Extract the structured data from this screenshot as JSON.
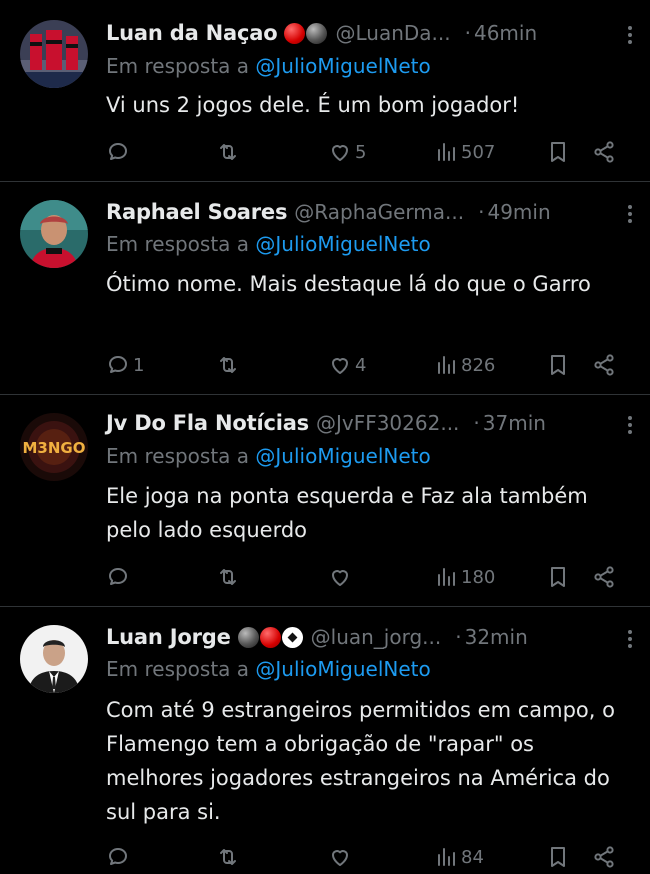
{
  "tweets": [
    {
      "name": "Luan da Naçao",
      "badges": [
        "red",
        "black"
      ],
      "handle": "@LuanDa...",
      "separator": "·",
      "time": "46min",
      "reply_prefix": "Em resposta a ",
      "reply_mention": "@JulioMiguelNeto",
      "text": "Vi uns 2 jogos dele. É um bom jogador!",
      "replies": "",
      "reposts": "",
      "likes": "5",
      "views": "507"
    },
    {
      "name": "Raphael Soares",
      "badges": [],
      "handle": "@RaphaGerma...",
      "separator": "·",
      "time": "49min",
      "reply_prefix": "Em resposta a ",
      "reply_mention": "@JulioMiguelNeto",
      "text": "Ótimo nome. Mais destaque lá do que o Garro",
      "replies": "1",
      "reposts": "",
      "likes": "4",
      "views": "826"
    },
    {
      "name": "Jv Do Fla Notícias",
      "badges": [],
      "handle": "@JvFF30262...",
      "separator": "·",
      "time": "37min",
      "reply_prefix": "Em resposta a ",
      "reply_mention": "@JulioMiguelNeto",
      "text": "Ele joga na ponta esquerda e Faz ala também pelo lado esquerdo",
      "replies": "",
      "reposts": "",
      "likes": "",
      "views": "180",
      "avatar_text": "M3NGO"
    },
    {
      "name": "Luan Jorge",
      "badges": [
        "black",
        "red",
        "ball"
      ],
      "handle": "@luan_jorg...",
      "separator": "·",
      "time": "32min",
      "reply_prefix": "Em resposta a ",
      "reply_mention": "@JulioMiguelNeto",
      "text": "Com até 9 estrangeiros permitidos em campo, o Flamengo tem a obrigação de \"rapar\" os melhores jogadores estrangeiros na América do sul para si.",
      "replies": "",
      "reposts": "",
      "likes": "",
      "views": "84"
    }
  ],
  "colors": {
    "background": "#000000",
    "text": "#e7e9ea",
    "muted": "#71767b",
    "mention": "#1d9bf0",
    "divider": "#2f3336"
  },
  "icons": {
    "more": "more-icon",
    "reply": "reply-icon",
    "repost": "repost-icon",
    "like": "like-icon",
    "views": "views-icon",
    "bookmark": "bookmark-icon",
    "share": "share-icon"
  }
}
